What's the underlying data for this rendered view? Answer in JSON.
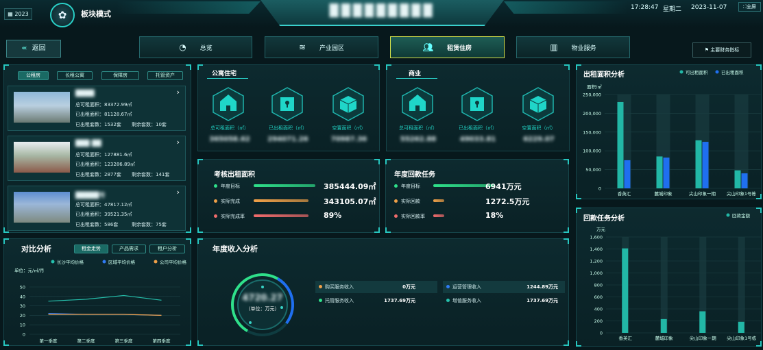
{
  "header": {
    "year": "2023",
    "mode_title": "板块模式",
    "center_title": "█████████",
    "time": "17:28:47",
    "weekday": "星期二",
    "date": "2023-11-07",
    "fullscreen": "全屏"
  },
  "nav": {
    "back": "返回",
    "tabs": [
      {
        "label": "总览",
        "icon": "pie-chart-icon"
      },
      {
        "label": "产业园区",
        "icon": "layers-icon"
      },
      {
        "label": "租赁住房",
        "icon": "people-icon"
      },
      {
        "label": "物业服务",
        "icon": "building-icon"
      }
    ],
    "finance": "主要财务指标"
  },
  "left_panel": {
    "tabs": [
      "公租房",
      "长租公寓",
      "保障房",
      "托管资产"
    ],
    "cards": [
      {
        "name": "████",
        "total": "总可租面积：83372.99㎡",
        "rented": "已出租面积：81128.67㎡",
        "sets": "已出租套数：1532套",
        "left": "剩余套数：10套"
      },
      {
        "name": "███ ██",
        "total": "总可租面积：127881.6㎡",
        "rented": "已出租面积：123286.89㎡",
        "sets": "已出租套数：2877套",
        "left": "剩余套数：141套"
      },
      {
        "name": "█████号",
        "total": "总可租面积：47817.12㎡",
        "rented": "已出租面积：39521.35㎡",
        "sets": "已出租套数：586套",
        "left": "剩余套数：75套"
      }
    ]
  },
  "apartment": {
    "title": "公寓住宅",
    "items": [
      {
        "label": "总可租面积（㎡）",
        "value": "365058.62"
      },
      {
        "label": "已出租面积（㎡）",
        "value": "294071.26"
      },
      {
        "label": "空置面积（㎡）",
        "value": "70987.36"
      }
    ]
  },
  "commercial": {
    "title": "商业",
    "items": [
      {
        "label": "总可租面积（㎡）",
        "value": "55262.88"
      },
      {
        "label": "已出租面积（㎡）",
        "value": "49033.81"
      },
      {
        "label": "空置面积（㎡）",
        "value": "6229.07"
      }
    ]
  },
  "assess": {
    "title": "考核出租面积",
    "rows": [
      {
        "label": "年度目标",
        "value": "385444.09㎡",
        "color": "#2fe08a",
        "pct": 1.0
      },
      {
        "label": "实际完成",
        "value": "343105.07㎡",
        "color": "#f0a048",
        "pct": 0.89
      },
      {
        "label": "实际完成率",
        "value": "89%",
        "color": "#f06c6c",
        "pct": 0.89
      }
    ]
  },
  "payment": {
    "title": "年度回款任务",
    "rows": [
      {
        "label": "年度目标",
        "value": "6941万元",
        "color": "#2fe08a",
        "pct": 1.0
      },
      {
        "label": "实际回款",
        "value": "1272.5万元",
        "color": "#f0a048",
        "pct": 0.18
      },
      {
        "label": "实际回款率",
        "value": "18%",
        "color": "#f06c6c",
        "pct": 0.18
      }
    ]
  },
  "compare": {
    "title": "对比分析",
    "tabs": [
      "租金走势",
      "产品需求",
      "租户分析"
    ],
    "chart_data": {
      "type": "line",
      "categories": [
        "第一季度",
        "第二季度",
        "第三季度",
        "第四季度"
      ],
      "series": [
        {
          "name": "长沙平均价格",
          "values": [
            35,
            37,
            41,
            36
          ],
          "color": "#26c1ad"
        },
        {
          "name": "区域平均价格",
          "values": [
            22,
            21,
            21,
            20
          ],
          "color": "#2f7cf5"
        },
        {
          "name": "公司平均价格",
          "values": [
            21,
            21,
            21,
            20
          ],
          "color": "#f0a048"
        }
      ],
      "ylabel": "单位：元/㎡/月",
      "ylim": [
        0,
        50
      ],
      "yticks": [
        0,
        10,
        20,
        30,
        40,
        50
      ]
    }
  },
  "income": {
    "title": "年度收入分析",
    "total": "4720.27",
    "unit": "（单位：万元）",
    "items": [
      {
        "label": "购买服务收入",
        "value": "0万元",
        "color": "#f0a048"
      },
      {
        "label": "运营管理收入",
        "value": "1244.89万元",
        "color": "#2f7cf5"
      },
      {
        "label": "托管服务收入",
        "value": "1737.69万元",
        "color": "#2fe08a"
      },
      {
        "label": "增值服务收入",
        "value": "1737.69万元",
        "color": "#26c1ad"
      }
    ]
  },
  "rent_area": {
    "title": "出租面积分析",
    "chart_data": {
      "type": "bar",
      "categories": [
        "香英汇",
        "麓城印象",
        "尖山印象一期",
        "尖山印象1号栋"
      ],
      "series": [
        {
          "name": "可出租面积",
          "values": [
            230000,
            85000,
            128000,
            48000
          ],
          "color": "#22b7a6"
        },
        {
          "name": "已出租面积",
          "values": [
            75000,
            82000,
            124000,
            40000
          ],
          "color": "#1f6ff0"
        }
      ],
      "ylabel": "面积/㎡",
      "ylim": [
        0,
        250000
      ],
      "yticks": [
        "0",
        "50,000",
        "100,000",
        "150,000",
        "200,000",
        "250,000"
      ]
    }
  },
  "payback": {
    "title": "回款任务分析",
    "chart_data": {
      "type": "bar",
      "categories": [
        "香英汇",
        "麓城印象",
        "尖山印象一期",
        "尖山印象1号栋"
      ],
      "series": [
        {
          "name": "回款金额",
          "values": [
            1410,
            230,
            360,
            185
          ],
          "color": "#22b7a6"
        }
      ],
      "ylabel": "万元",
      "ylim": [
        0,
        1600
      ],
      "yticks": [
        "0",
        "200",
        "400",
        "600",
        "800",
        "1,000",
        "1,200",
        "1,400",
        "1,600"
      ]
    }
  }
}
